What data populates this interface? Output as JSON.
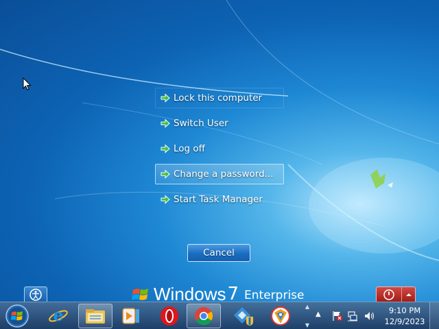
{
  "menu": {
    "items": [
      {
        "label": "Lock this computer"
      },
      {
        "label": "Switch User"
      },
      {
        "label": "Log off"
      },
      {
        "label": "Change a password..."
      },
      {
        "label": "Start Task Manager"
      }
    ]
  },
  "cancel_label": "Cancel",
  "branding": {
    "word": "Windows",
    "version": "7",
    "edition": "Enterprise"
  },
  "taskbar": {
    "icons": [
      "windows-start-icon",
      "internet-explorer-icon",
      "file-explorer-icon",
      "media-player-icon",
      "opera-icon",
      "chrome-icon",
      "network-app-icon",
      "vpn-app-icon"
    ],
    "tray_icons": [
      "action-center-flag-icon",
      "network-icon",
      "volume-icon"
    ]
  },
  "clock": {
    "time": "9:10 PM",
    "date": "12/9/2023"
  },
  "colors": {
    "power_button": "#b3261f",
    "desktop_blue": "#0d63b4",
    "arrow_green": "#3cc23c"
  }
}
